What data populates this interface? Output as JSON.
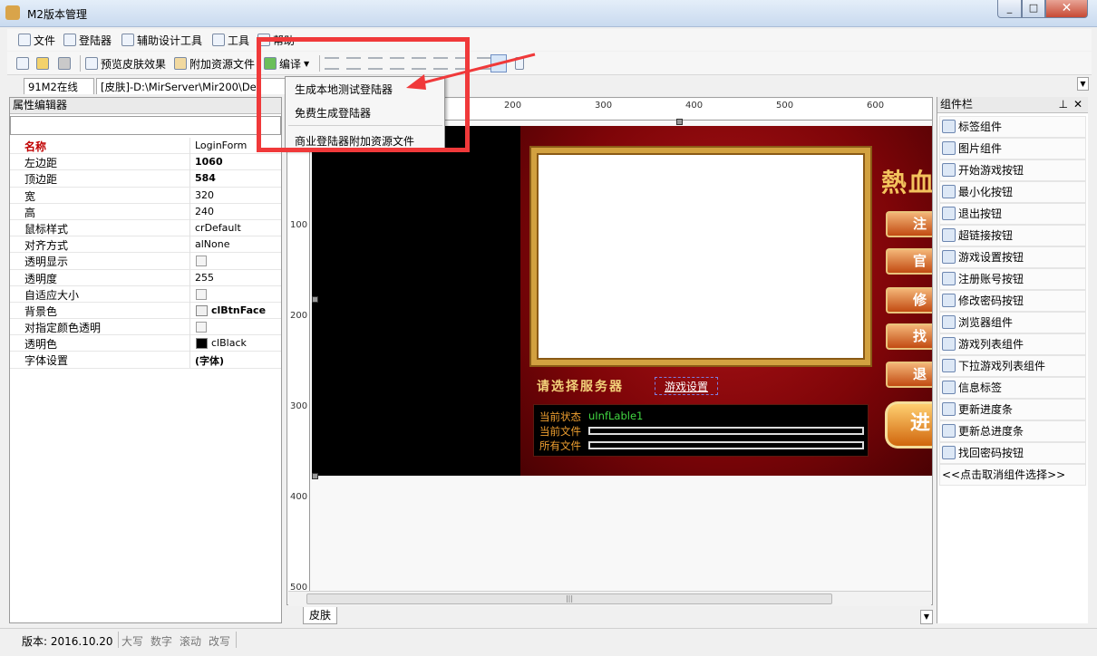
{
  "window": {
    "title": "M2版本管理",
    "close_glyph": "✕",
    "min_glyph": "_",
    "max_glyph": "□"
  },
  "menubar": {
    "items": [
      "文件",
      "登陆器",
      "辅助设计工具",
      "工具",
      "帮助"
    ]
  },
  "toolbar": {
    "preview_label": "预览皮肤效果",
    "attach_label": "附加资源文件",
    "compile_label": "编译"
  },
  "tabs": [
    "91M2在线",
    "[皮肤]-D:\\MirServer\\Mir200\\De"
  ],
  "compile_menu": {
    "items": [
      "生成本地测试登陆器",
      "免费生成登陆器",
      "商业登陆器附加资源文件"
    ]
  },
  "property_editor": {
    "title": "属性编辑器",
    "rows": [
      {
        "key": "名称",
        "value": "LoginForm",
        "type": "text",
        "highlight": true
      },
      {
        "key": "左边距",
        "value": "1060",
        "type": "bold"
      },
      {
        "key": "顶边距",
        "value": "584",
        "type": "bold"
      },
      {
        "key": "宽",
        "value": "320",
        "type": "text"
      },
      {
        "key": "高",
        "value": "240",
        "type": "text"
      },
      {
        "key": "鼠标样式",
        "value": "crDefault",
        "type": "text"
      },
      {
        "key": "对齐方式",
        "value": "alNone",
        "type": "text"
      },
      {
        "key": "透明显示",
        "value": "",
        "type": "check"
      },
      {
        "key": "透明度",
        "value": "255",
        "type": "text"
      },
      {
        "key": "自适应大小",
        "value": "",
        "type": "check"
      },
      {
        "key": "背景色",
        "value": "clBtnFace",
        "type": "color-bold",
        "swatch": "#f0f0f0"
      },
      {
        "key": "对指定颜色透明",
        "value": "",
        "type": "check"
      },
      {
        "key": "透明色",
        "value": "clBlack",
        "type": "color",
        "swatch": "#000000"
      },
      {
        "key": "字体设置",
        "value": "(字体)",
        "type": "bold"
      }
    ]
  },
  "ruler": {
    "h": [
      "200",
      "300",
      "400",
      "500",
      "600"
    ],
    "v": [
      "100",
      "200",
      "300",
      "400",
      "500"
    ]
  },
  "skin": {
    "logo": "熱血",
    "side_buttons": [
      "注",
      "官",
      "修",
      "找",
      "退"
    ],
    "start_button": "进",
    "select_server": "请选择服务器",
    "game_settings": "游戏设置",
    "status_label": "当前状态",
    "status_value": "uInfLable1",
    "file_label": "当前文件",
    "all_label": "所有文件"
  },
  "scroll_grip": "|||",
  "bottom_tab": "皮肤",
  "components": {
    "title": "组件栏",
    "items": [
      "标签组件",
      "图片组件",
      "开始游戏按钮",
      "最小化按钮",
      "退出按钮",
      "超链接按钮",
      "游戏设置按钮",
      "注册账号按钮",
      "修改密码按钮",
      "浏览器组件",
      "游戏列表组件",
      "下拉游戏列表组件",
      "信息标签",
      "更新进度条",
      "更新总进度条",
      "找回密码按钮",
      "<<点击取消组件选择>>"
    ]
  },
  "statusbar": {
    "version": "版本: 2016.10.20",
    "caps": "大写",
    "num": "数字",
    "scroll": "滚动",
    "ins": "改写"
  }
}
